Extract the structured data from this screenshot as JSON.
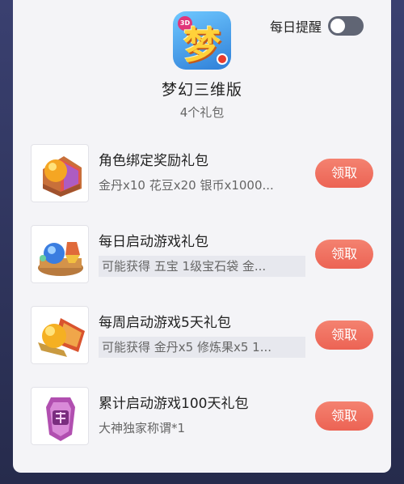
{
  "header": {
    "app_icon_glyph": "梦",
    "app_icon_tag": "3D",
    "app_title": "梦幻三维版",
    "gift_count": "4个礼包",
    "daily_reminder_label": "每日提醒",
    "daily_reminder_on": false
  },
  "gifts": [
    {
      "title": "角色绑定奖励礼包",
      "desc": "金丹x10 花豆x20 银币x1000...",
      "claim_label": "领取",
      "thumb_icon": "peach-treasure-chest-icon"
    },
    {
      "title": "每日启动游戏礼包",
      "desc": "可能获得 五宝 1级宝石袋 金...",
      "claim_label": "领取",
      "thumb_icon": "gem-treasure-icon"
    },
    {
      "title": "每周启动游戏5天礼包",
      "desc": "可能获得 金丹x5 修炼果x5 1...",
      "claim_label": "领取",
      "thumb_icon": "golden-peach-scroll-icon"
    },
    {
      "title": "累计启动游戏100天礼包",
      "desc": "大神独家称谓*1",
      "claim_label": "领取",
      "thumb_icon": "title-badge-icon"
    }
  ],
  "colors": {
    "claim_button": "#ec6354",
    "panel_bg": "#f4f4f7",
    "backdrop": "#2e3458"
  }
}
